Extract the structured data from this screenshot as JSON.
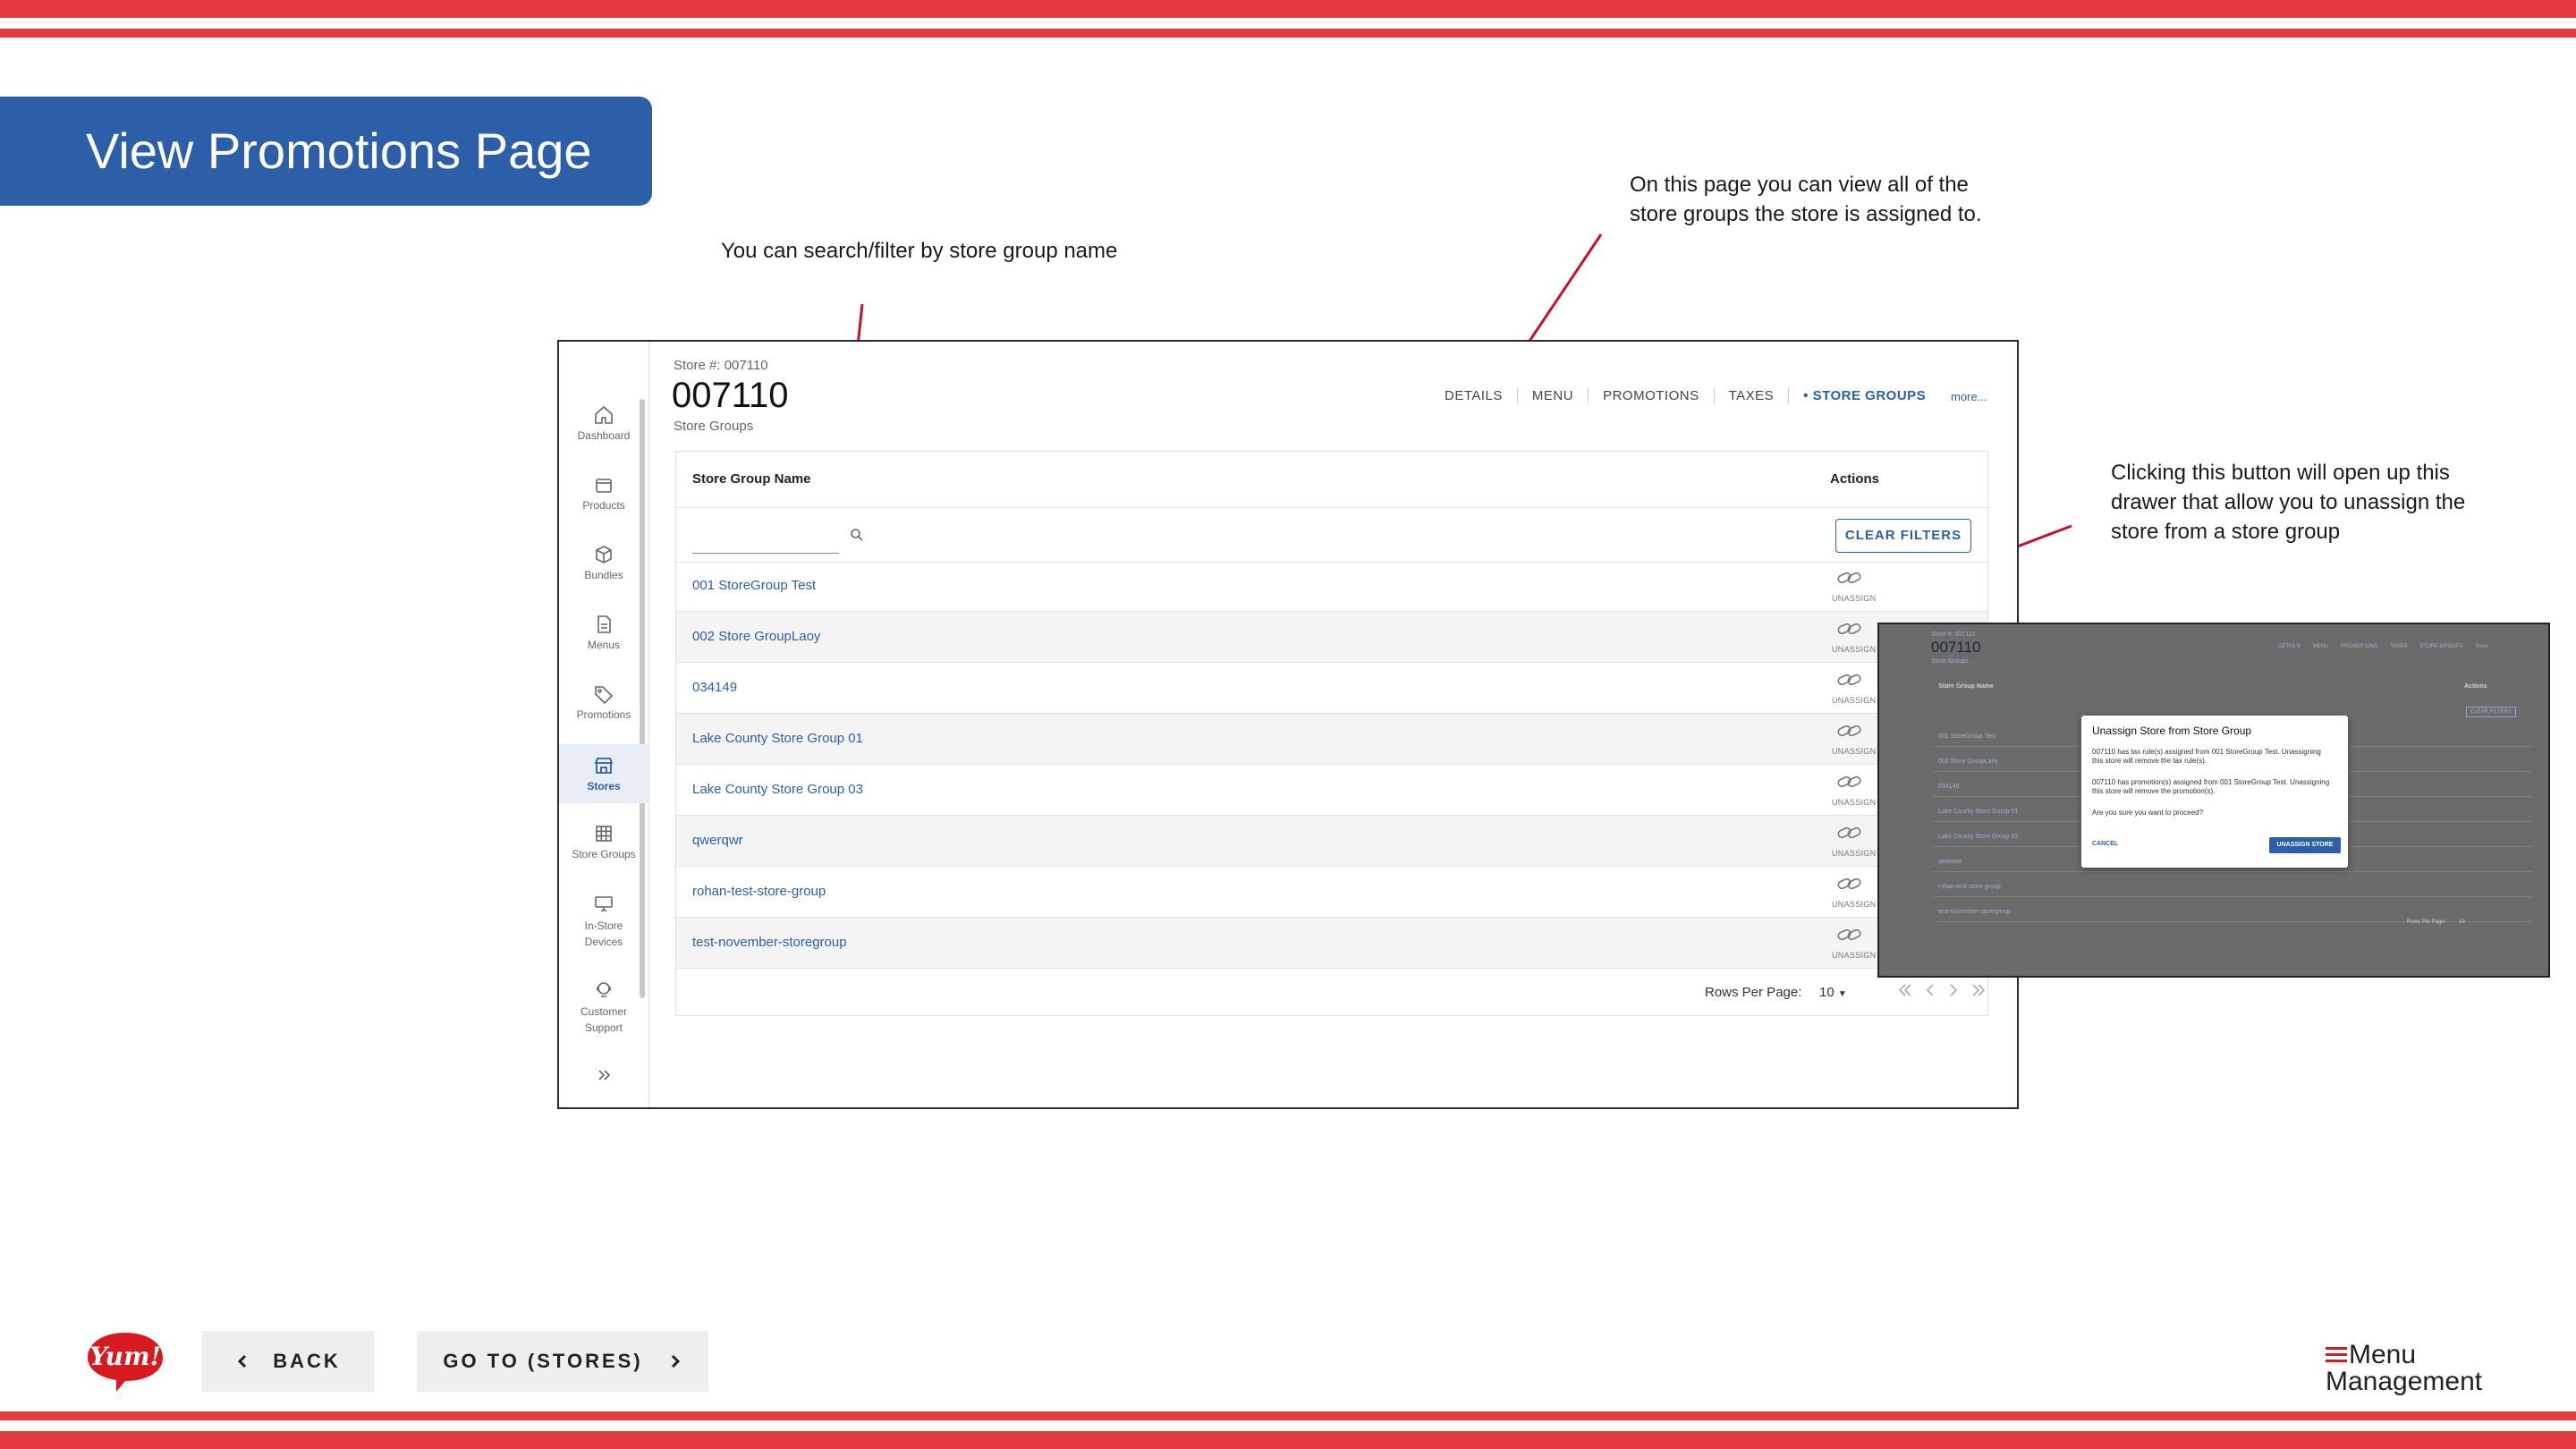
{
  "slide": {
    "title": "View Promotions Page",
    "annotations": {
      "search": "You can search/filter by store group name",
      "view_groups": "On this page you can view all of the store groups the store is assigned to.",
      "drawer": "Clicking this button will open up this drawer that allow you to unassign the store from a store group"
    },
    "colors": {
      "stripe": "#e33b3f",
      "banner": "#2d5fa8",
      "arrow": "#c8102e"
    }
  },
  "sidebar": {
    "items": [
      {
        "label": "Dashboard",
        "icon": "home-icon"
      },
      {
        "label": "Products",
        "icon": "box-icon"
      },
      {
        "label": "Bundles",
        "icon": "cube-icon"
      },
      {
        "label": "Menus",
        "icon": "document-icon"
      },
      {
        "label": "Promotions",
        "icon": "tag-icon"
      },
      {
        "label": "Stores",
        "icon": "storefront-icon",
        "active": true
      },
      {
        "label": "Store Groups",
        "icon": "grid-icon"
      },
      {
        "label": "In-Store Devices",
        "icon": "monitor-icon"
      },
      {
        "label": "Customer Support",
        "icon": "headset-icon"
      }
    ],
    "expand_icon": "double-chevron-right-icon"
  },
  "header": {
    "store_number_label": "Store #: 007110",
    "store_title": "007110",
    "subtitle": "Store Groups",
    "tabs": [
      "DETAILS",
      "MENU",
      "PROMOTIONS",
      "TAXES",
      "STORE GROUPS"
    ],
    "active_tab": "STORE GROUPS",
    "more_label": "more..."
  },
  "table": {
    "columns": [
      "Store Group Name",
      "Actions"
    ],
    "filter_placeholder": "",
    "clear_filters_label": "CLEAR FILTERS",
    "action_label": "UNASSIGN",
    "rows": [
      "001 StoreGroup Test",
      "002 Store GroupLaoy",
      "034149",
      "Lake County Store Group 01",
      "Lake County Store Group 03",
      "qwerqwr",
      "rohan-test-store-group",
      "test-november-storegroup"
    ],
    "rows_per_page_label": "Rows Per Page:",
    "rows_per_page_value": "10"
  },
  "modal": {
    "store_num": "Store #: 007110",
    "store_title": "007110",
    "subtitle": "Store Groups",
    "tabs": [
      "DETAILS",
      "MENU",
      "PROMOTIONS",
      "TAXES",
      "STORE GROUPS",
      "more"
    ],
    "column_header": "Store Group Name",
    "actions_header": "Actions",
    "clear_filters_label": "CLEAR FILTERS",
    "rows": [
      "001 StoreGroup Test",
      "002 Store GroupLaoy",
      "034149",
      "Lake County Store Group 01",
      "Lake County Store Group 03",
      "qwerqwr",
      "rohan-test-store-group",
      "test-november-storegroup"
    ],
    "rows_per_page_label": "Rows Per Page:",
    "rows_per_page_value": "10",
    "dialog_title": "Unassign Store from Store Group",
    "paragraph1": "007110 has tax rule(s) assigned from 001 StoreGroup Test. Unassigning this store will remove the tax rule(s).",
    "paragraph2": "007110 has promotion(s) assigned from 001 StoreGroup Test. Unassigning this store will remove the promotion(s).",
    "paragraph3": "Are you sure you want to proceed?",
    "cancel_label": "CANCEL",
    "confirm_label": "UNASSIGN STORE"
  },
  "footer": {
    "back_label": "BACK",
    "goto_label": "GO TO (STORES)",
    "brand_logo_text": "Yum!",
    "product_logo_line1": "Menu",
    "product_logo_line2": "Management"
  }
}
